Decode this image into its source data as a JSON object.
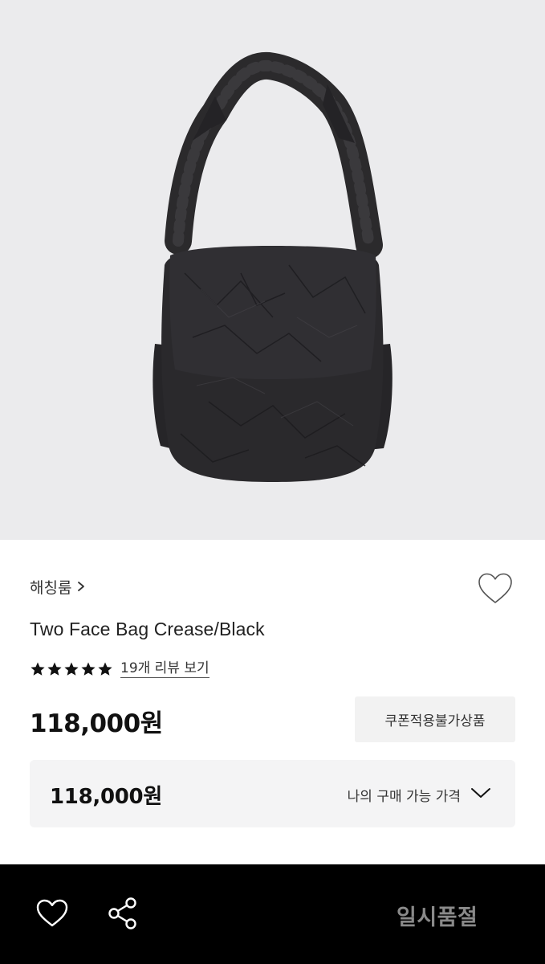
{
  "product": {
    "image_alt": "black crinkled shoulder bag",
    "background_color": "#ebebed",
    "brand": "해칭룸",
    "title": "Two Face Bag Crease/Black",
    "rating_stars": 5,
    "review_link": "19개 리뷰 보기",
    "price": "118,000원",
    "coupon_badge": "쿠폰적용불가상품"
  },
  "my_price": {
    "value": "118,000원",
    "label": "나의 구매 가능 가격"
  },
  "bottom_bar": {
    "soldout_label": "일시품절",
    "background_color": "#000000"
  },
  "icons": {
    "brand": "chevron-right-icon",
    "wishlist": "heart-outline-icon",
    "star": "star-filled-icon",
    "expand": "chevron-down-icon",
    "share": "share-icon"
  }
}
